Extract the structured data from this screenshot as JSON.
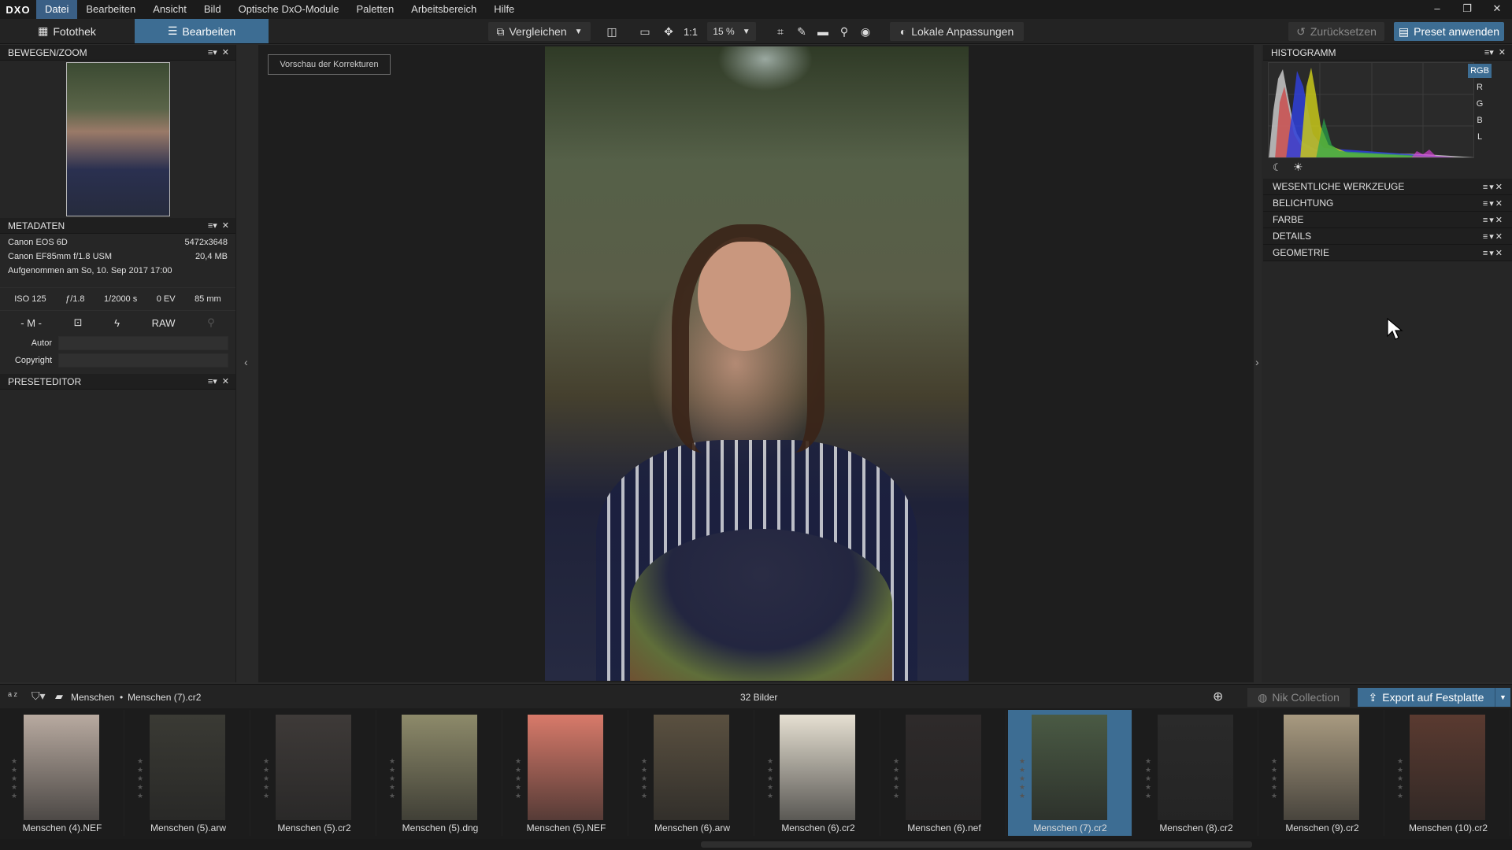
{
  "menu": {
    "logo": "DXO",
    "items": [
      "Datei",
      "Bearbeiten",
      "Ansicht",
      "Bild",
      "Optische DxO-Module",
      "Paletten",
      "Arbeitsbereich",
      "Hilfe"
    ],
    "window_controls": [
      "–",
      "❐",
      "✕"
    ]
  },
  "toolbar": {
    "tab_library": "Fotothek",
    "tab_edit": "Bearbeiten",
    "compare": "Vergleichen",
    "one_to_one": "1:1",
    "zoom": "15 %",
    "local_adjust": "Lokale Anpassungen",
    "reset": "Zurücksetzen",
    "apply_preset": "Preset anwenden"
  },
  "left": {
    "move_zoom_title": "BEWEGEN/ZOOM",
    "metadata_title": "METADATEN",
    "camera": "Canon EOS 6D",
    "resolution": "5472x3648",
    "lens": "Canon EF85mm f/1.8 USM",
    "filesize": "20,4 MB",
    "taken": "Aufgenommen am So, 10. Sep 2017 17:00",
    "iso": "ISO 125",
    "aperture": "ƒ/1.8",
    "shutter": "1/2000 s",
    "ev": "0 EV",
    "focal": "85 mm",
    "mode": "- M -",
    "format": "RAW",
    "author_label": "Autor",
    "copyright_label": "Copyright",
    "preset_editor_title": "PRESETEDITOR"
  },
  "viewer": {
    "preview_button": "Vorschau der Korrekturen"
  },
  "right": {
    "histogram_title": "HISTOGRAMM",
    "channels": [
      "RGB",
      "R",
      "G",
      "B",
      "L"
    ],
    "sections": [
      "WESENTLICHE WERKZEUGE",
      "BELICHTUNG",
      "FARBE",
      "DETAILS",
      "GEOMETRIE"
    ]
  },
  "strip": {
    "sort_label": "a z",
    "folder": "Menschen",
    "separator": "•",
    "current_file": "Menschen (7).cr2",
    "count": "32 Bilder",
    "nik": "Nik Collection",
    "export": "Export auf Festplatte"
  },
  "thumbnails": [
    {
      "name": "Menschen (4).NEF",
      "color": "#b8aaa0"
    },
    {
      "name": "Menschen (5).arw",
      "color": "#3a3a34"
    },
    {
      "name": "Menschen (5).cr2",
      "color": "#3e3a38"
    },
    {
      "name": "Menschen (5).dng",
      "color": "#8d8a6a"
    },
    {
      "name": "Menschen (5).NEF",
      "color": "#d87a6a"
    },
    {
      "name": "Menschen (6).arw",
      "color": "#5a5040"
    },
    {
      "name": "Menschen (6).cr2",
      "color": "#e6e0d2"
    },
    {
      "name": "Menschen (6).nef",
      "color": "#2e2a2a"
    },
    {
      "name": "Menschen (7).cr2",
      "color": "#4a5a44",
      "selected": true
    },
    {
      "name": "Menschen (8).cr2",
      "color": "#2a2a2a"
    },
    {
      "name": "Menschen (9).cr2",
      "color": "#a89a80"
    },
    {
      "name": "Menschen (10).cr2",
      "color": "#5a3a30"
    }
  ]
}
